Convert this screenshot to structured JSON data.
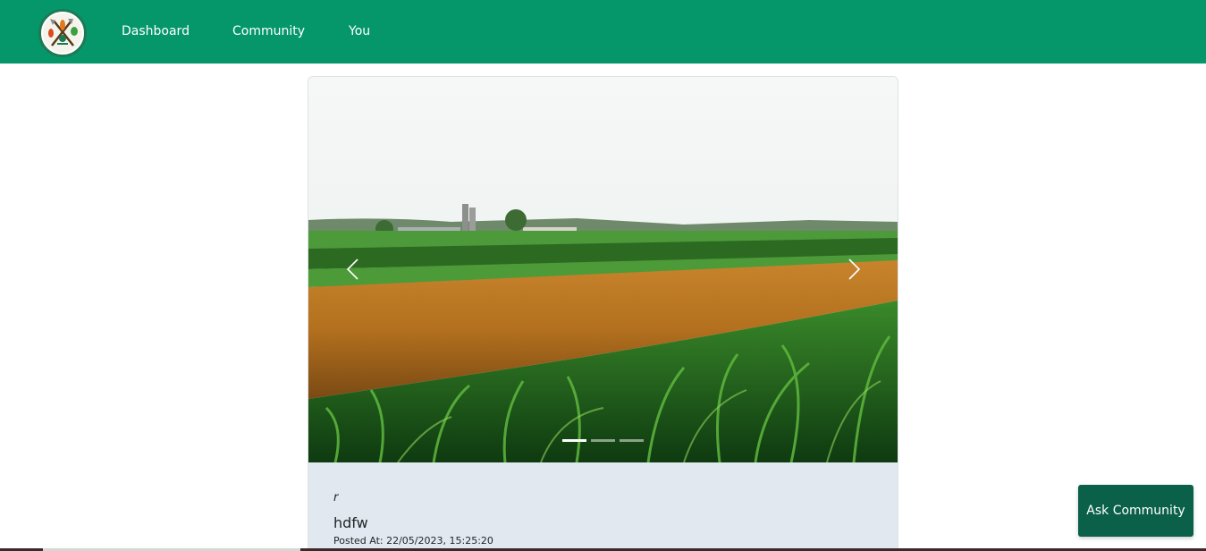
{
  "nav": {
    "logo_icon": "farm-tools-logo-icon",
    "links": [
      "Dashboard",
      "Community",
      "You"
    ]
  },
  "post": {
    "image_description_icon": "farm-field-image",
    "category": "r",
    "title": "hdfw",
    "posted_at": "Posted At: 22/05/2023, 15:25:20",
    "carousel": {
      "slide_count": 3,
      "active_index": 0,
      "prev_icon": "chevron-left-icon",
      "next_icon": "chevron-right-icon"
    }
  },
  "ask_button": {
    "label": "Ask Community"
  },
  "colors": {
    "navbar": "#05976a",
    "card_body": "#e2e8f0",
    "ask_button": "#0a6048"
  }
}
